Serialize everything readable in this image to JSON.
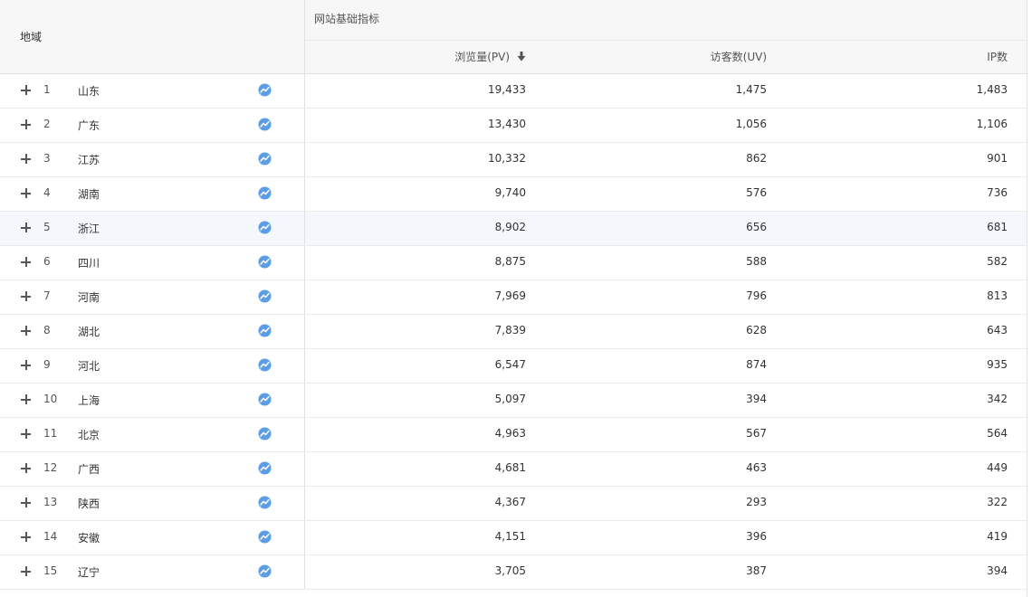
{
  "header": {
    "region_label": "地域",
    "group_label": "网站基础指标",
    "pv_label": "浏览量(PV)",
    "uv_label": "访客数(UV)",
    "ip_label": "IP数"
  },
  "icons": {
    "sort": "arrow-down-icon",
    "expand": "plus-icon",
    "trend": "trend-chart-icon"
  },
  "colors": {
    "trend_icon": "#5b9ee6",
    "highlight_row": "#f4f8fd",
    "header_bg": "#f7f7f7"
  },
  "rows": [
    {
      "rank": "1",
      "province": "山东",
      "pv": "19,433",
      "uv": "1,475",
      "ip": "1,483"
    },
    {
      "rank": "2",
      "province": "广东",
      "pv": "13,430",
      "uv": "1,056",
      "ip": "1,106"
    },
    {
      "rank": "3",
      "province": "江苏",
      "pv": "10,332",
      "uv": "862",
      "ip": "901"
    },
    {
      "rank": "4",
      "province": "湖南",
      "pv": "9,740",
      "uv": "576",
      "ip": "736"
    },
    {
      "rank": "5",
      "province": "浙江",
      "pv": "8,902",
      "uv": "656",
      "ip": "681"
    },
    {
      "rank": "6",
      "province": "四川",
      "pv": "8,875",
      "uv": "588",
      "ip": "582"
    },
    {
      "rank": "7",
      "province": "河南",
      "pv": "7,969",
      "uv": "796",
      "ip": "813"
    },
    {
      "rank": "8",
      "province": "湖北",
      "pv": "7,839",
      "uv": "628",
      "ip": "643"
    },
    {
      "rank": "9",
      "province": "河北",
      "pv": "6,547",
      "uv": "874",
      "ip": "935"
    },
    {
      "rank": "10",
      "province": "上海",
      "pv": "5,097",
      "uv": "394",
      "ip": "342"
    },
    {
      "rank": "11",
      "province": "北京",
      "pv": "4,963",
      "uv": "567",
      "ip": "564"
    },
    {
      "rank": "12",
      "province": "广西",
      "pv": "4,681",
      "uv": "463",
      "ip": "449"
    },
    {
      "rank": "13",
      "province": "陕西",
      "pv": "4,367",
      "uv": "293",
      "ip": "322"
    },
    {
      "rank": "14",
      "province": "安徽",
      "pv": "4,151",
      "uv": "396",
      "ip": "419"
    },
    {
      "rank": "15",
      "province": "辽宁",
      "pv": "3,705",
      "uv": "387",
      "ip": "394"
    }
  ]
}
